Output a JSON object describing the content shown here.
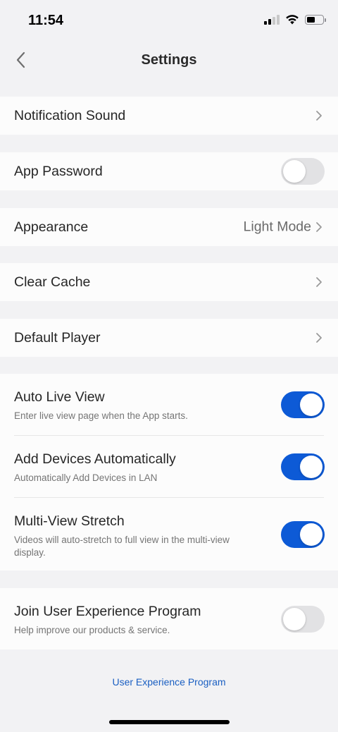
{
  "status_bar": {
    "time": "11:54"
  },
  "header": {
    "title": "Settings"
  },
  "rows": {
    "notification_sound": "Notification Sound",
    "app_password": "App Password",
    "appearance": "Appearance",
    "appearance_value": "Light Mode",
    "clear_cache": "Clear Cache",
    "default_player": "Default Player"
  },
  "toggles": {
    "auto_live_view": {
      "label": "Auto Live View",
      "desc": "Enter live view page when the App starts.",
      "on": true
    },
    "add_devices": {
      "label": "Add Devices Automatically",
      "desc": "Automatically Add Devices in LAN",
      "on": true
    },
    "multi_view": {
      "label": "Multi-View Stretch",
      "desc": "Videos will auto-stretch to full view in the multi-view display.",
      "on": true
    },
    "user_experience": {
      "label": "Join User Experience Program",
      "desc": "Help improve our products & service.",
      "on": false
    }
  },
  "app_password_on": false,
  "footer": {
    "link": "User Experience Program"
  },
  "colors": {
    "accent": "#0d5ad6",
    "link": "#1a5fc2",
    "background": "#f2f2f4"
  },
  "icons": [
    "back-chevron-icon",
    "chevron-right-icon",
    "signal-icon",
    "wifi-icon",
    "battery-icon"
  ]
}
